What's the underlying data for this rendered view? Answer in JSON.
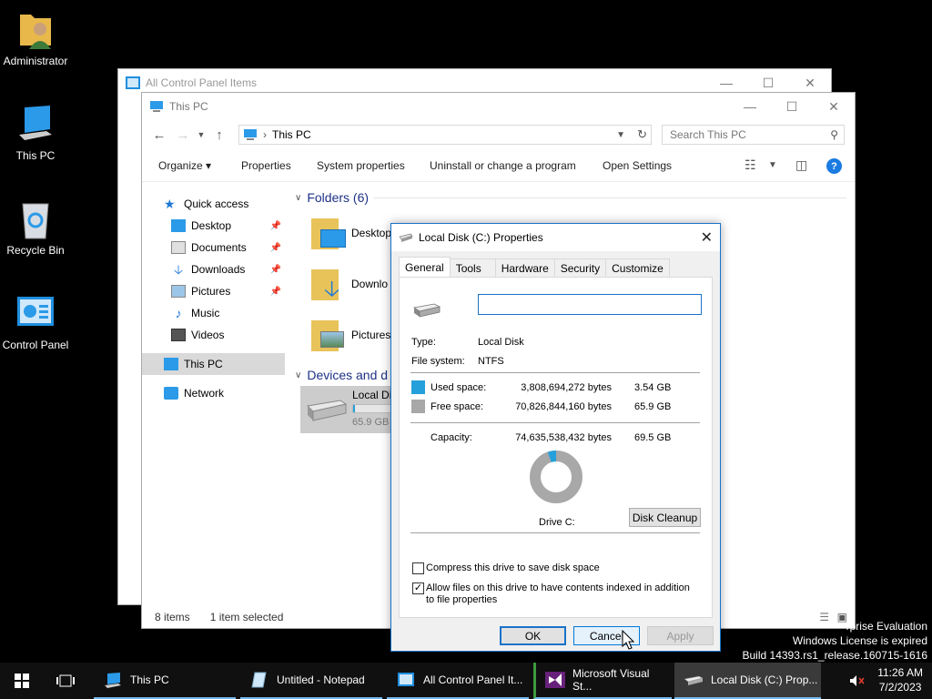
{
  "desktop": {
    "icons": [
      {
        "label": "Administrator"
      },
      {
        "label": "This PC"
      },
      {
        "label": "Recycle Bin"
      },
      {
        "label": "Control Panel"
      }
    ],
    "watermark": [
      "rprise Evaluation",
      "Windows License is expired",
      "Build 14393.rs1_release.160715-1616"
    ]
  },
  "control_panel_window": {
    "title": "All Control Panel Items"
  },
  "explorer": {
    "title": "This PC",
    "address": "This PC",
    "search_placeholder": "Search This PC",
    "commands": [
      "Organize",
      "Properties",
      "System properties",
      "Uninstall or change a program",
      "Open Settings"
    ],
    "nav": {
      "quick_access": "Quick access",
      "pinned": [
        "Desktop",
        "Documents",
        "Downloads",
        "Pictures"
      ],
      "others": [
        "Music",
        "Videos"
      ],
      "this_pc": "This PC",
      "network": "Network"
    },
    "folders_header": "Folders (6)",
    "folders": [
      "Desktop",
      "Downlo",
      "Pictures"
    ],
    "devices_header": "Devices and d",
    "drive": {
      "name": "Local Di",
      "free": "65.9 GB",
      "used_fraction": 0.05
    },
    "status": {
      "items": "8 items",
      "selected": "1 item selected"
    }
  },
  "properties_dialog": {
    "title": "Local Disk (C:) Properties",
    "tabs": [
      "General",
      "Tools",
      "Hardware",
      "Security",
      "Customize"
    ],
    "active_tab": "General",
    "drive_name_value": "",
    "type_label": "Type:",
    "type_value": "Local Disk",
    "fs_label": "File system:",
    "fs_value": "NTFS",
    "used_label": "Used space:",
    "used_bytes": "3,808,694,272 bytes",
    "used_gb": "3.54 GB",
    "free_label": "Free space:",
    "free_bytes": "70,826,844,160 bytes",
    "free_gb": "65.9 GB",
    "capacity_label": "Capacity:",
    "capacity_bytes": "74,635,538,432 bytes",
    "capacity_gb": "69.5 GB",
    "used_fraction": 0.051,
    "drive_label": "Drive C:",
    "disk_cleanup": "Disk Cleanup",
    "compress_label": "Compress this drive to save disk space",
    "compress_checked": false,
    "index_label": "Allow files on this drive to have contents indexed in addition to file properties",
    "index_checked": true,
    "ok": "OK",
    "cancel": "Cancel",
    "apply": "Apply",
    "colors": {
      "used": "#26a0da",
      "free": "#a8a8a8"
    }
  },
  "taskbar": {
    "items": [
      "This PC",
      "Untitled - Notepad",
      "All Control Panel It...",
      "Microsoft Visual St...",
      "Local Disk (C:) Prop..."
    ],
    "time": "11:26 AM",
    "date": "7/2/2023"
  }
}
